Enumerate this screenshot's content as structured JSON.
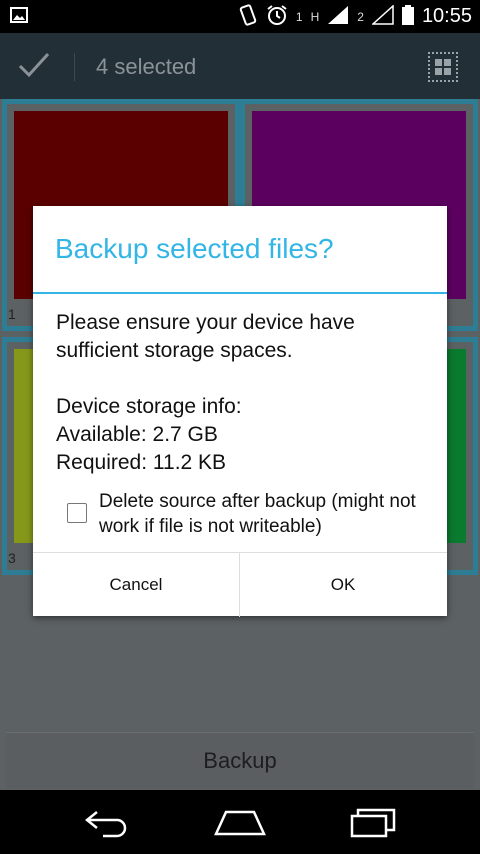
{
  "status_bar": {
    "time": "10:55",
    "sim1": "1",
    "sim2": "2",
    "net1": "H"
  },
  "action_bar": {
    "title": "4 selected"
  },
  "tiles": [
    {
      "number": "1",
      "color": "#5a0000"
    },
    {
      "number": "",
      "color": "#5c0060"
    },
    {
      "number": "3",
      "color": "#86981a"
    },
    {
      "number": "",
      "color": "#0a7a2e"
    }
  ],
  "dialog": {
    "title": "Backup selected files?",
    "message": "Please ensure your device have\nsufficient storage spaces.\n\nDevice storage info:\nAvailable: 2.7 GB\nRequired: 11.2 KB",
    "checkbox_label": "Delete source after backup (might not work if file is not writeable)",
    "checkbox_checked": false,
    "cancel_label": "Cancel",
    "ok_label": "OK"
  },
  "bottom_button": {
    "label": "Backup"
  },
  "colors": {
    "accent": "#33b5e5",
    "action_bar": "#232f36",
    "selection_border": "#2d7d95"
  }
}
